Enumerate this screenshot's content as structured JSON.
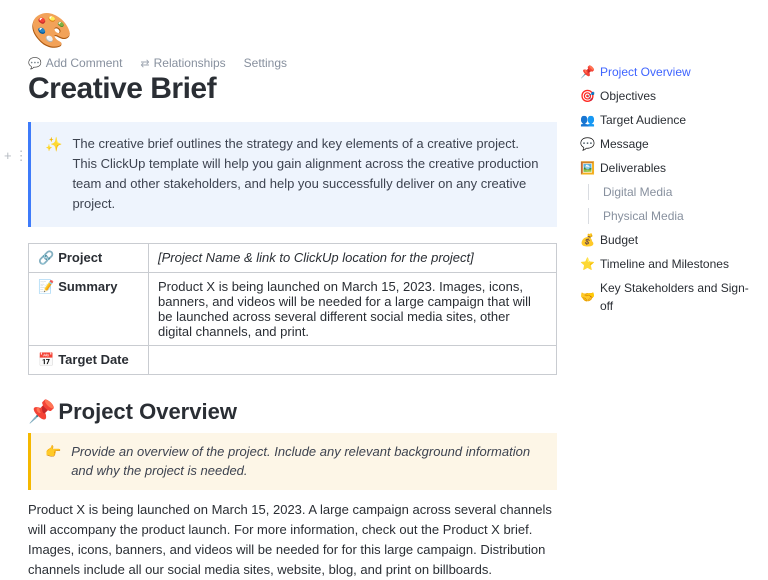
{
  "header": {
    "palette_emoji": "🎨",
    "toolbar": {
      "comment": "Add Comment",
      "relationships": "Relationships",
      "settings": "Settings"
    },
    "title": "Creative Brief"
  },
  "intro_callout": {
    "icon": "✨",
    "text": "The creative brief outlines the strategy and key elements of a creative project. This ClickUp template will help you gain alignment across the creative production team and other stakeholders, and help you successfully deliver on any creative project."
  },
  "info_table": {
    "row1": {
      "icon": "🔗",
      "label": "Project",
      "value": "[Project Name & link to ClickUp location for the project]"
    },
    "row2": {
      "icon": "📝",
      "label": "Summary",
      "value": "Product X is being launched on March 15, 2023. Images, icons, banners, and videos will be needed for a large campaign that will be launched across several different social media sites, other digital channels, and print."
    },
    "row3": {
      "icon": "📅",
      "label": "Target Date",
      "value": ""
    }
  },
  "section_overview": {
    "icon": "📌",
    "title": "Project Overview",
    "hint_icon": "👉",
    "hint": "Provide an overview of the project. Include any relevant background information and why the project is needed.",
    "body": "Product X is being launched on March 15, 2023. A large campaign across several channels will accompany the product launch. For more information, check out the Product X brief. Images, icons, banners, and videos will be needed for for this large campaign. Distribution channels include all our social media sites, website, blog, and print on billboards."
  },
  "nav": {
    "items": [
      {
        "icon": "📌",
        "label": "Project Overview",
        "active": true
      },
      {
        "icon": "🎯",
        "label": "Objectives"
      },
      {
        "icon": "👥",
        "label": "Target Audience"
      },
      {
        "icon": "💬",
        "label": "Message"
      },
      {
        "icon": "🖼️",
        "label": "Deliverables"
      },
      {
        "label": "Digital Media",
        "sub": true
      },
      {
        "label": "Physical Media",
        "sub": true
      },
      {
        "icon": "💰",
        "label": "Budget"
      },
      {
        "icon": "⭐",
        "label": "Timeline and Milestones"
      },
      {
        "icon": "🤝",
        "label": "Key Stakeholders and Sign-off"
      }
    ]
  }
}
